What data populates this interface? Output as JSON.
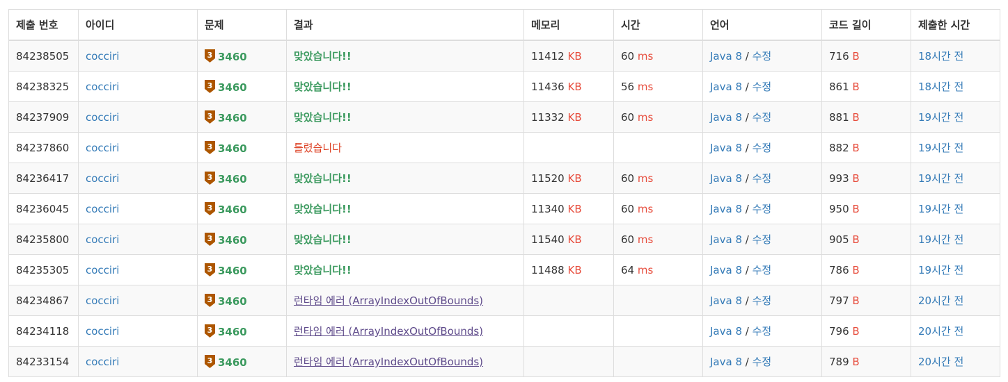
{
  "colors": {
    "accepted": "#3c9a5f",
    "wrong": "#dd4124",
    "runtime_error": "#5f4b8b",
    "link": "#337ab7",
    "unit": "#e74c3c",
    "bronze_tier": "#ad5600"
  },
  "headers": {
    "submission_id": "제출 번호",
    "user_id": "아이디",
    "problem": "문제",
    "result": "결과",
    "memory": "메모리",
    "time": "시간",
    "language": "언어",
    "code_length": "코드 길이",
    "submitted_at": "제출한 시간"
  },
  "labels": {
    "memory_unit": "KB",
    "time_unit": "ms",
    "length_unit": "B",
    "edit": "수정",
    "separator": " / ",
    "tier_digit": "3",
    "tier_icon": "bronze-tier-icon"
  },
  "rows": [
    {
      "id": "84238505",
      "user": "cocciri",
      "problem": "3460",
      "result": "맞았습니다!!",
      "result_type": "ok",
      "memory": "11412",
      "time": "60",
      "lang": "Java 8",
      "length": "716",
      "ago": "18시간 전"
    },
    {
      "id": "84238325",
      "user": "cocciri",
      "problem": "3460",
      "result": "맞았습니다!!",
      "result_type": "ok",
      "memory": "11436",
      "time": "56",
      "lang": "Java 8",
      "length": "861",
      "ago": "18시간 전"
    },
    {
      "id": "84237909",
      "user": "cocciri",
      "problem": "3460",
      "result": "맞았습니다!!",
      "result_type": "ok",
      "memory": "11332",
      "time": "60",
      "lang": "Java 8",
      "length": "881",
      "ago": "19시간 전"
    },
    {
      "id": "84237860",
      "user": "cocciri",
      "problem": "3460",
      "result": "틀렸습니다",
      "result_type": "wa",
      "memory": "",
      "time": "",
      "lang": "Java 8",
      "length": "882",
      "ago": "19시간 전"
    },
    {
      "id": "84236417",
      "user": "cocciri",
      "problem": "3460",
      "result": "맞았습니다!!",
      "result_type": "ok",
      "memory": "11520",
      "time": "60",
      "lang": "Java 8",
      "length": "993",
      "ago": "19시간 전"
    },
    {
      "id": "84236045",
      "user": "cocciri",
      "problem": "3460",
      "result": "맞았습니다!!",
      "result_type": "ok",
      "memory": "11340",
      "time": "60",
      "lang": "Java 8",
      "length": "950",
      "ago": "19시간 전"
    },
    {
      "id": "84235800",
      "user": "cocciri",
      "problem": "3460",
      "result": "맞았습니다!!",
      "result_type": "ok",
      "memory": "11540",
      "time": "60",
      "lang": "Java 8",
      "length": "905",
      "ago": "19시간 전"
    },
    {
      "id": "84235305",
      "user": "cocciri",
      "problem": "3460",
      "result": "맞았습니다!!",
      "result_type": "ok",
      "memory": "11488",
      "time": "64",
      "lang": "Java 8",
      "length": "786",
      "ago": "19시간 전"
    },
    {
      "id": "84234867",
      "user": "cocciri",
      "problem": "3460",
      "result": "런타임 에러 (ArrayIndexOutOfBounds)",
      "result_type": "rte",
      "memory": "",
      "time": "",
      "lang": "Java 8",
      "length": "797",
      "ago": "20시간 전"
    },
    {
      "id": "84234118",
      "user": "cocciri",
      "problem": "3460",
      "result": "런타임 에러 (ArrayIndexOutOfBounds)",
      "result_type": "rte",
      "memory": "",
      "time": "",
      "lang": "Java 8",
      "length": "796",
      "ago": "20시간 전"
    },
    {
      "id": "84233154",
      "user": "cocciri",
      "problem": "3460",
      "result": "런타임 에러 (ArrayIndexOutOfBounds)",
      "result_type": "rte",
      "memory": "",
      "time": "",
      "lang": "Java 8",
      "length": "789",
      "ago": "20시간 전"
    }
  ]
}
